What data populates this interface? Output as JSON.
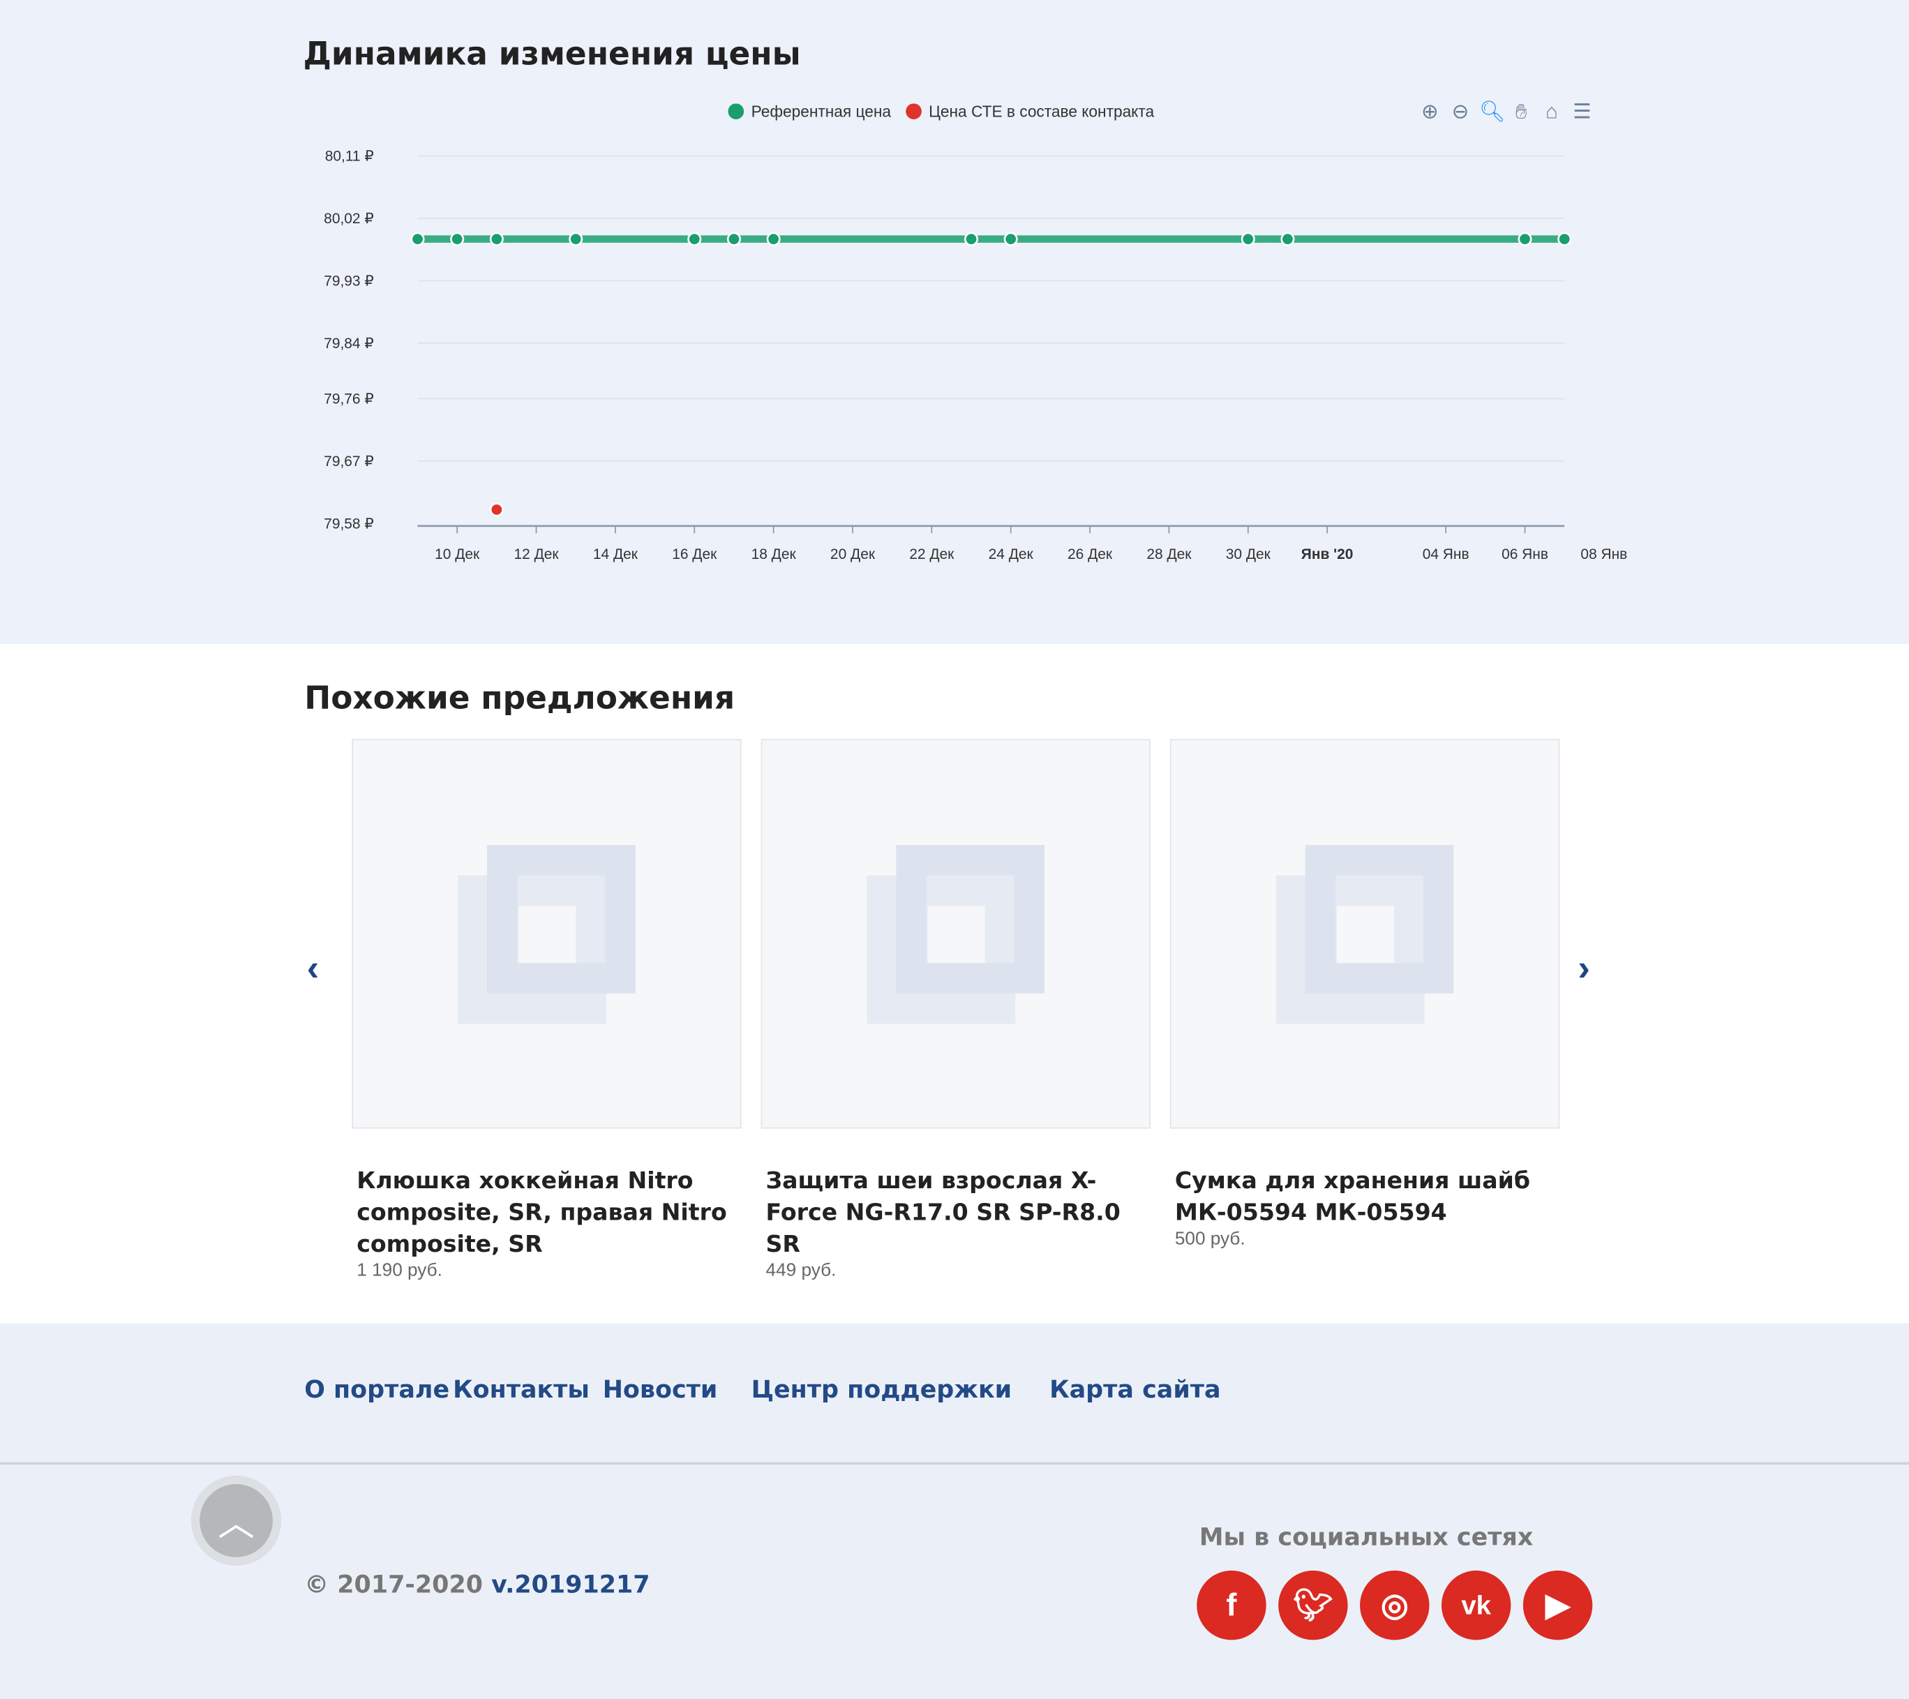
{
  "price_section": {
    "title": "Динамика изменения цены"
  },
  "chart_data": {
    "type": "line",
    "title": "",
    "legend": {
      "placement": "top-center",
      "entries": [
        "Референтная цена",
        "Цена СТЕ в составе контракта"
      ]
    },
    "series": [
      {
        "name": "Референтная цена",
        "color": "#1a9e6e",
        "points": [
          [
            "2019-12-09",
            79.99
          ],
          [
            "2019-12-10",
            79.99
          ],
          [
            "2019-12-11",
            79.99
          ],
          [
            "2019-12-13",
            79.99
          ],
          [
            "2019-12-16",
            79.99
          ],
          [
            "2019-12-17",
            79.99
          ],
          [
            "2019-12-18",
            79.99
          ],
          [
            "2019-12-23",
            79.99
          ],
          [
            "2019-12-24",
            79.99
          ],
          [
            "2019-12-30",
            79.99
          ],
          [
            "2019-12-31",
            79.99
          ],
          [
            "2020-01-06",
            79.99
          ],
          [
            "2020-01-07",
            79.99
          ]
        ]
      },
      {
        "name": "Цена СТЕ в составе контракта",
        "color": "#e0332b",
        "points": [
          [
            "2019-12-11",
            79.6
          ]
        ]
      }
    ],
    "yticks": [
      "80,11 ₽",
      "80,02 ₽",
      "79,93 ₽",
      "79,84 ₽",
      "79,76 ₽",
      "79,67 ₽",
      "79,58 ₽"
    ],
    "ytick_values": [
      80.11,
      80.02,
      79.93,
      79.84,
      79.76,
      79.67,
      79.58
    ],
    "ylim": [
      79.58,
      80.11
    ],
    "xlim": [
      "2019-12-09",
      "2020-01-07"
    ],
    "xticks": [
      [
        "2019-12-10",
        "10 Дек"
      ],
      [
        "2019-12-12",
        "12 Дек"
      ],
      [
        "2019-12-14",
        "14 Дек"
      ],
      [
        "2019-12-16",
        "16 Дек"
      ],
      [
        "2019-12-18",
        "18 Дек"
      ],
      [
        "2019-12-20",
        "20 Дек"
      ],
      [
        "2019-12-22",
        "22 Дек"
      ],
      [
        "2019-12-24",
        "24 Дек"
      ],
      [
        "2019-12-26",
        "26 Дек"
      ],
      [
        "2019-12-28",
        "28 Дек"
      ],
      [
        "2019-12-30",
        "30 Дек"
      ],
      [
        "2020-01-01",
        "Янв '20"
      ],
      [
        "2020-01-04",
        "04 Янв"
      ],
      [
        "2020-01-06",
        "06 Янв"
      ],
      [
        "2020-01-08",
        "08 Янв"
      ]
    ],
    "grid": true
  },
  "toolbar": {
    "icons": [
      "zoom-in-icon",
      "zoom-out-icon",
      "selection-zoom-icon",
      "pan-icon",
      "home-icon",
      "menu-icon"
    ],
    "active_color": "#1a8cff"
  },
  "similar": {
    "title": "Похожие предложения",
    "items": [
      {
        "title": "Клюшка хоккейная Nitro composite, SR, правая Nitro composite, SR",
        "price": "1 190 руб."
      },
      {
        "title": "Защита шеи взрослая X-Force NG-R17.0 SR SP-R8.0 SR",
        "price": "449 руб."
      },
      {
        "title": "Сумка для хранения шайб МК-05594 МК-05594",
        "price": "500 руб."
      }
    ]
  },
  "footer": {
    "links": [
      "О портале",
      "Контакты",
      "Новости",
      "Центр поддержки",
      "Карта сайта"
    ],
    "copyright": "© 2017-2020",
    "version": "v.20191217",
    "social_title": "Мы в социальных сетях",
    "social": [
      "facebook",
      "twitter",
      "instagram",
      "vk",
      "youtube"
    ],
    "social_color": "#da2a22"
  }
}
